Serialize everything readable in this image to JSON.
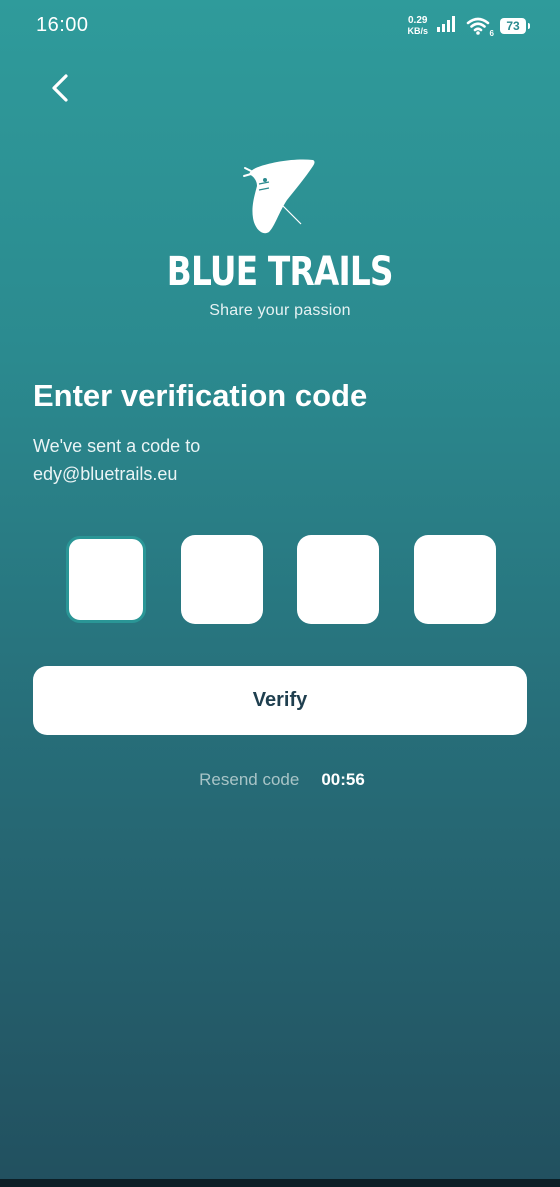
{
  "status_bar": {
    "time": "16:00",
    "net_speed_value": "0.29",
    "net_speed_unit": "KB/s",
    "wifi_badge": "6",
    "battery": "73"
  },
  "brand": {
    "name": "BLUE TRAILS",
    "tagline": "Share your passion"
  },
  "form": {
    "title": "Enter verification code",
    "line1": "We've sent a code to",
    "email": "edy@bluetrails.eu",
    "code_boxes": [
      "",
      "",
      "",
      ""
    ],
    "verify_label": "Verify",
    "resend_label": "Resend code",
    "timer": "00:56"
  },
  "colors": {
    "gradient_top": "#2f9b9b",
    "gradient_bottom": "#22505f",
    "button_text": "#1f3f4f",
    "active_box_border": "#2a9696"
  }
}
